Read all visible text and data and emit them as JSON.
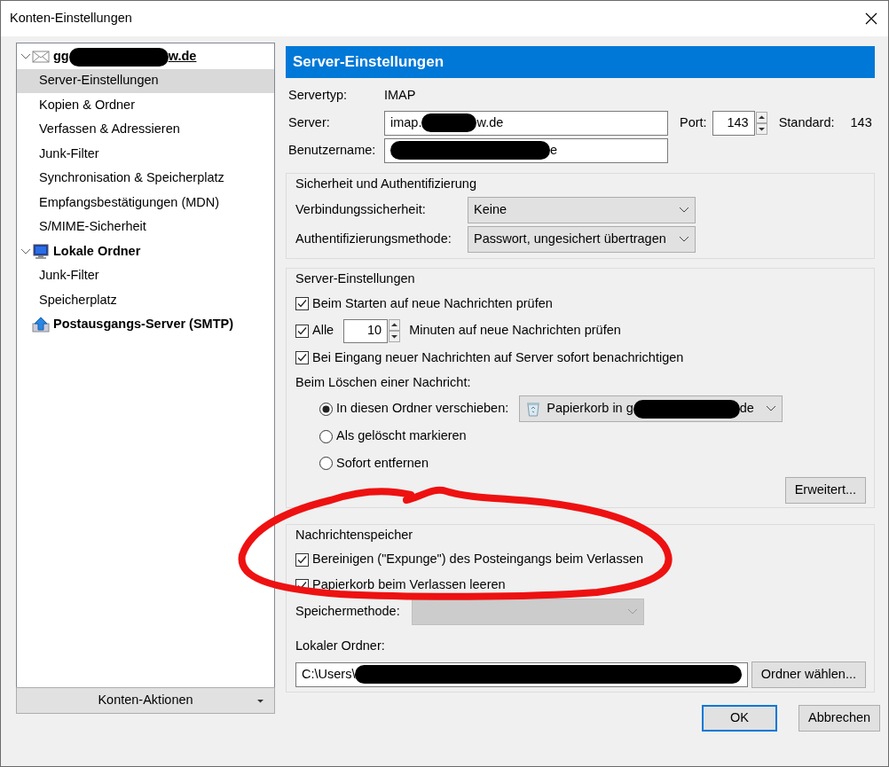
{
  "window": {
    "title": "Konten-Einstellungen"
  },
  "tree": [
    {
      "kind": "mail",
      "expanded": true,
      "selected": false,
      "segments": [
        {
          "kind": "text",
          "text": "gg"
        },
        {
          "kind": "redacted"
        },
        {
          "kind": "text",
          "text": "w.de"
        }
      ],
      "children": [
        {
          "label": "Server-Einstellungen",
          "selected": true
        },
        {
          "label": "Kopien & Ordner",
          "selected": false
        },
        {
          "label": "Verfassen & Adressieren",
          "selected": false
        },
        {
          "label": "Junk-Filter",
          "selected": false
        },
        {
          "label": "Synchronisation & Speicherplatz",
          "selected": false
        },
        {
          "label": "Empfangsbestätigungen (MDN)",
          "selected": false
        },
        {
          "label": "S/MIME-Sicherheit",
          "selected": false
        }
      ]
    },
    {
      "kind": "local",
      "expanded": true,
      "selected": false,
      "segments": [
        {
          "kind": "text",
          "text": "Lokale Ordner"
        }
      ],
      "children": [
        {
          "label": "Junk-Filter",
          "selected": false
        },
        {
          "label": "Speicherplatz",
          "selected": false
        }
      ]
    },
    {
      "kind": "smtp",
      "selected": false,
      "segments": [
        {
          "kind": "text",
          "text": "Postausgangs-Server (SMTP)"
        }
      ]
    }
  ],
  "account_actions": {
    "label": "Konten-Aktionen"
  },
  "panel": {
    "title": "Server-Einstellungen",
    "server_type": {
      "label": "Servertyp:",
      "value": "IMAP"
    },
    "server": {
      "label": "Server:",
      "segments": [
        {
          "kind": "text",
          "text": "imap."
        },
        {
          "kind": "redacted"
        },
        {
          "kind": "text",
          "text": "w.de"
        }
      ]
    },
    "port": {
      "label": "Port:",
      "value": "143"
    },
    "default_port": {
      "label": "Standard:",
      "value": "143"
    },
    "username": {
      "label": "Benutzername:",
      "segments": [
        {
          "kind": "redacted"
        },
        {
          "kind": "text",
          "text": "e"
        }
      ]
    },
    "security": {
      "title": "Sicherheit und Authentifizierung",
      "rows": [
        {
          "label": "Verbindungssicherheit:",
          "value": "Keine"
        },
        {
          "label": "Authentifizierungsmethode:",
          "value": "Passwort, ungesichert übertragen"
        }
      ]
    },
    "server_settings": {
      "title": "Server-Einstellungen",
      "check_on_start": {
        "label": "Beim Starten auf neue Nachrichten prüfen",
        "checked": true
      },
      "interval": {
        "label": "Alle",
        "checked": true,
        "value": "10",
        "suffix": "Minuten auf neue Nachrichten prüfen"
      },
      "notify": {
        "label": "Bei Eingang neuer Nachrichten auf Server sofort benachrichtigen",
        "checked": true
      },
      "delete_label": "Beim Löschen einer Nachricht:",
      "delete_options": [
        {
          "label": "In diesen Ordner verschieben:",
          "selected": true,
          "folder": {
            "segments": [
              {
                "kind": "text",
                "text": "Papierkorb in g"
              },
              {
                "kind": "redacted"
              },
              {
                "kind": "text",
                "text": "de"
              }
            ]
          }
        },
        {
          "label": "Als gelöscht markieren",
          "selected": false
        },
        {
          "label": "Sofort entfernen",
          "selected": false
        }
      ],
      "advanced_button": "Erweitert..."
    },
    "storage": {
      "title": "Nachrichtenspeicher",
      "checks": [
        {
          "label": "Bereinigen (\"Expunge\") des Posteingangs beim Verlassen",
          "checked": true
        },
        {
          "label": "Papierkorb beim Verlassen leeren",
          "checked": true
        }
      ],
      "store_method": {
        "label": "Speichermethode:",
        "disabled": true
      },
      "local_folder": {
        "label": "Lokaler Ordner:",
        "segments": [
          {
            "kind": "text",
            "text": "C:\\Users\\"
          },
          {
            "kind": "redacted"
          }
        ]
      },
      "choose_button": "Ordner wählen..."
    }
  },
  "buttons": [
    {
      "label": "OK",
      "default": true
    },
    {
      "label": "Abbrechen",
      "default": false
    }
  ],
  "annotation": {
    "kind": "freehand-ellipse"
  }
}
